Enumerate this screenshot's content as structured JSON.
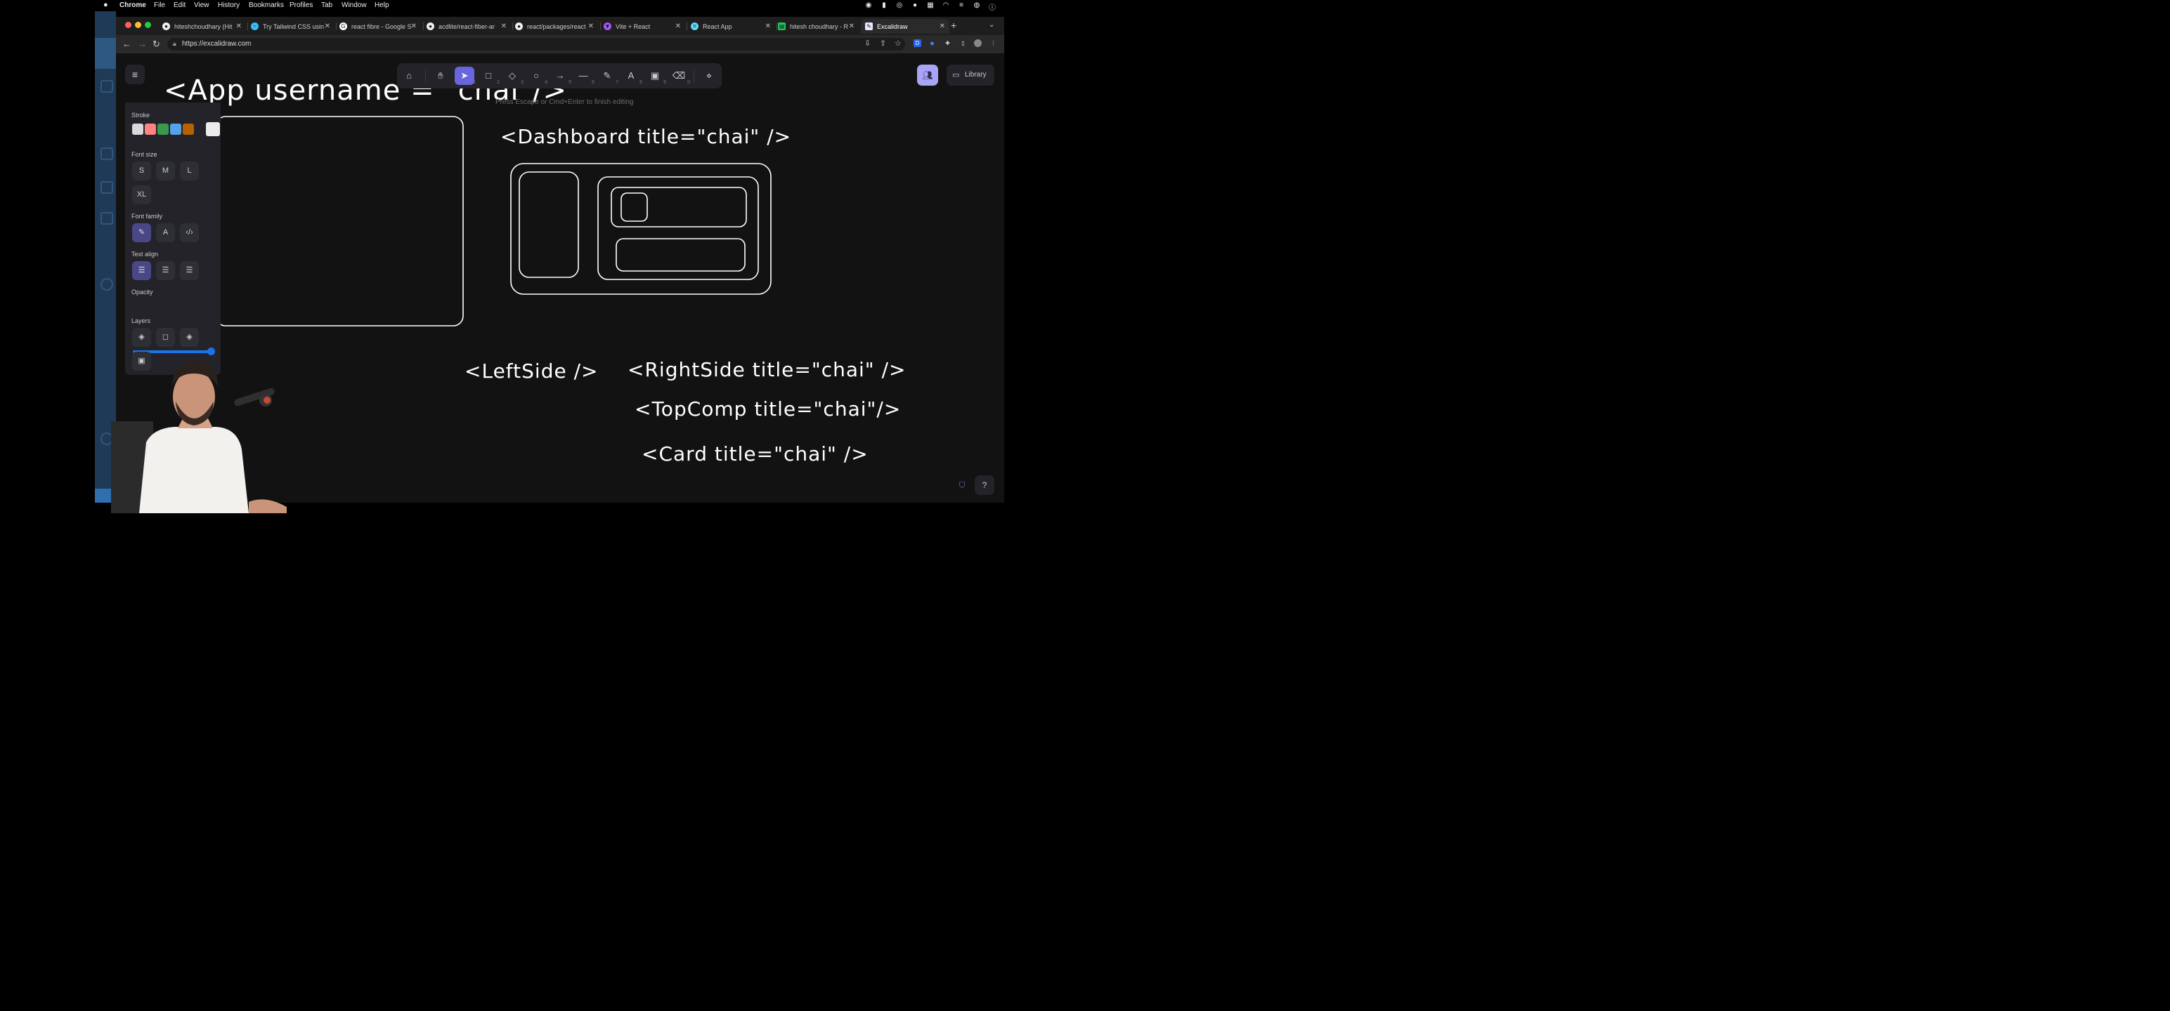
{
  "mac_menu": {
    "apple": "",
    "items": [
      "Chrome",
      "File",
      "Edit",
      "View",
      "History",
      "Bookmarks",
      "Profiles",
      "Tab",
      "Window",
      "Help"
    ]
  },
  "tabs": [
    {
      "title": "hiteshchoudhary (Hit",
      "favicon": "github-icon"
    },
    {
      "title": "Try Tailwind CSS usin",
      "favicon": "tailwind-icon"
    },
    {
      "title": "react fibre - Google S",
      "favicon": "google-icon"
    },
    {
      "title": "acdlite/react-fiber-ar",
      "favicon": "github-icon"
    },
    {
      "title": "react/packages/react",
      "favicon": "github-icon"
    },
    {
      "title": "Vite + React",
      "favicon": "vite-icon"
    },
    {
      "title": "React App",
      "favicon": "react-icon"
    },
    {
      "title": "hitesh choudhary - R",
      "favicon": "sheet-icon"
    },
    {
      "title": "Excalidraw",
      "favicon": "excalidraw-icon"
    }
  ],
  "address": {
    "url": "https://excalidraw.com"
  },
  "toolbar": {
    "tools": [
      {
        "name": "lock",
        "num": ""
      },
      {
        "name": "hand",
        "num": ""
      },
      {
        "name": "selection",
        "num": "1"
      },
      {
        "name": "rectangle",
        "num": "2"
      },
      {
        "name": "diamond",
        "num": "3"
      },
      {
        "name": "ellipse",
        "num": "4"
      },
      {
        "name": "arrow",
        "num": "5"
      },
      {
        "name": "line",
        "num": "6"
      },
      {
        "name": "draw",
        "num": "7"
      },
      {
        "name": "text",
        "num": "8"
      },
      {
        "name": "image",
        "num": "9"
      },
      {
        "name": "eraser",
        "num": "0"
      },
      {
        "name": "more-tools",
        "num": ""
      }
    ],
    "hint": "Press Escape or Cmd+Enter to finish editing"
  },
  "top_right": {
    "library_label": "Library"
  },
  "properties": {
    "stroke_label": "Stroke",
    "stroke_colors": [
      "#d9d9d9",
      "#ff8383",
      "#3a994c",
      "#56a2e8",
      "#b76100"
    ],
    "current_stroke": "#ececec",
    "font_size_label": "Font size",
    "font_sizes": [
      "S",
      "M",
      "L",
      "XL"
    ],
    "font_family_label": "Font family",
    "text_align_label": "Text align",
    "opacity_label": "Opacity",
    "opacity_value": 100,
    "layers_label": "Layers"
  },
  "drawing": {
    "app_text": "<App username = \"chai\"/>",
    "dashboard_text": "<Dashboard title=\"chai\" />",
    "leftside_text": "<LeftSide />",
    "rightside_text": "<RightSide title=\"chai\" />",
    "topcomp_text": "<TopComp  title=\"chai\"/>",
    "card_text": "<Card title=\"chai\" />"
  },
  "colors": {
    "accent": "#6965db",
    "collab": "#a8a4f6",
    "canvas_bg": "#121212"
  }
}
